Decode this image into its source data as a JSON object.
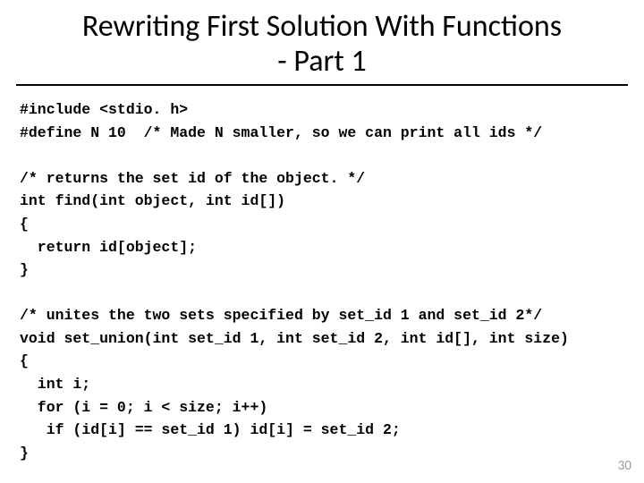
{
  "title": "Rewriting First Solution With Functions\n- Part 1",
  "code": "#include <stdio. h>\n#define N 10  /* Made N smaller, so we can print all ids */\n\n/* returns the set id of the object. */\nint find(int object, int id[])\n{\n  return id[object];\n}\n\n/* unites the two sets specified by set_id 1 and set_id 2*/\nvoid set_union(int set_id 1, int set_id 2, int id[], int size)\n{\n  int i;\n  for (i = 0; i < size; i++)\n   if (id[i] == set_id 1) id[i] = set_id 2;\n}",
  "page_number": "30"
}
